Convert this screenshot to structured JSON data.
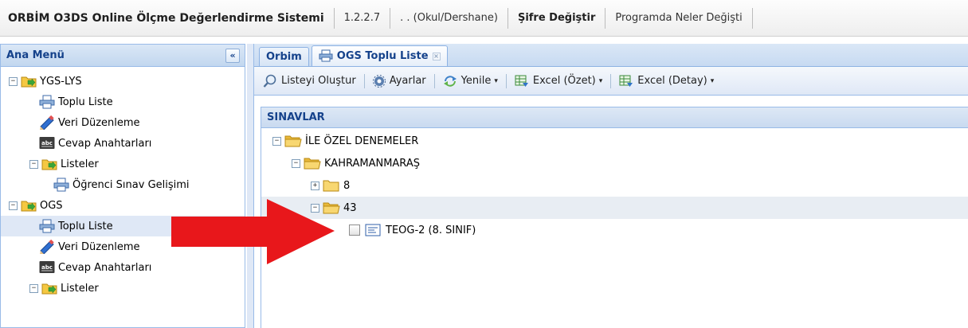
{
  "topbar": {
    "app_title": "ORBİM O3DS Online Ölçme Değerlendirme Sistemi",
    "version": "1.2.2.7",
    "school": ". . (Okul/Dershane)",
    "change_password": "Şifre Değiştir",
    "whats_new": "Programda Neler Değişti"
  },
  "sidebar": {
    "title": "Ana Menü",
    "collapse_glyph": "«",
    "items": [
      {
        "label": "YGS-LYS",
        "icon": "folder-arrow-icon",
        "toggle": "−"
      },
      {
        "label": "Toplu Liste",
        "icon": "printer-icon"
      },
      {
        "label": "Veri Düzenleme",
        "icon": "pencil-icon"
      },
      {
        "label": "Cevap Anahtarları",
        "icon": "abc-icon"
      },
      {
        "label": "Listeler",
        "icon": "folder-arrow-icon",
        "toggle": "−"
      },
      {
        "label": "Öğrenci Sınav Gelişimi",
        "icon": "printer-icon"
      },
      {
        "label": "OGS",
        "icon": "folder-arrow-icon",
        "toggle": "−"
      },
      {
        "label": "Toplu Liste",
        "icon": "printer-icon",
        "selected": true
      },
      {
        "label": "Veri Düzenleme",
        "icon": "pencil-icon"
      },
      {
        "label": "Cevap Anahtarları",
        "icon": "abc-icon"
      },
      {
        "label": "Listeler",
        "icon": "folder-arrow-icon",
        "toggle": "−"
      }
    ]
  },
  "tabs": [
    {
      "label": "Orbim",
      "active": false
    },
    {
      "label": "OGS Toplu Liste",
      "active": true,
      "icon": "printer-icon",
      "close": "×"
    }
  ],
  "toolbar": {
    "create_list": "Listeyi Oluştur",
    "settings": "Ayarlar",
    "refresh": "Yenile",
    "excel_summary": "Excel (Özet)",
    "excel_detail": "Excel (Detay)",
    "dropdown_glyph": "▾"
  },
  "exams": {
    "header": "SINAVLAR",
    "nodes": [
      {
        "label": "İLE ÖZEL DENEMELER",
        "toggle": "−"
      },
      {
        "label": "KAHRAMANMARAŞ",
        "toggle": "−"
      },
      {
        "label": "8",
        "toggle": "+"
      },
      {
        "label": "43",
        "toggle": "−"
      },
      {
        "label": "TEOG-2 (8. SINIF)"
      }
    ]
  },
  "colors": {
    "header_text": "#15428b",
    "panel_border": "#99bbe8",
    "selection": "#dfe8f6",
    "arrow": "#e8171b",
    "folder": "#f5c842"
  }
}
